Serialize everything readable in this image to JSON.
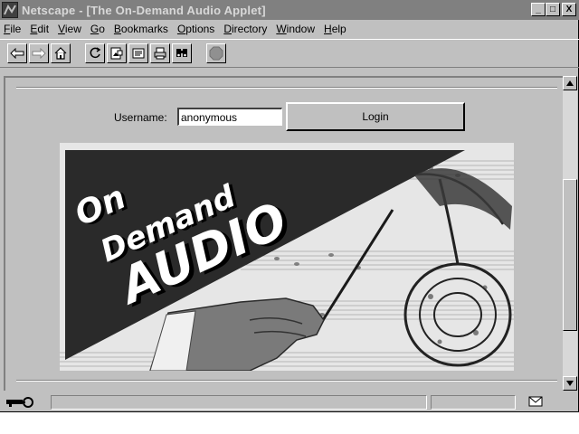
{
  "window": {
    "title": "Netscape - [The On-Demand Audio Applet]",
    "controls": [
      "_",
      "□",
      "X"
    ]
  },
  "menu": [
    {
      "label": "File",
      "key": "F",
      "rest": "ile"
    },
    {
      "label": "Edit",
      "key": "E",
      "rest": "dit"
    },
    {
      "label": "View",
      "key": "V",
      "rest": "iew"
    },
    {
      "label": "Go",
      "key": "G",
      "rest": "o"
    },
    {
      "label": "Bookmarks",
      "key": "B",
      "rest": "ookmarks"
    },
    {
      "label": "Options",
      "key": "O",
      "rest": "ptions"
    },
    {
      "label": "Directory",
      "key": "D",
      "rest": "irectory"
    },
    {
      "label": "Window",
      "key": "W",
      "rest": "indow"
    },
    {
      "label": "Help",
      "key": "H",
      "rest": "elp"
    }
  ],
  "toolbar": {
    "icons": [
      "back-arrow-icon",
      "forward-arrow-icon",
      "home-icon",
      "reload-icon",
      "images-icon",
      "open-icon",
      "print-icon",
      "find-icon",
      "stop-icon"
    ]
  },
  "login": {
    "username_label": "Username:",
    "username_value": "anonymous",
    "login_button": "Login"
  },
  "banner": {
    "line1": "On",
    "line2": "Demand",
    "line3": "AUDIO"
  },
  "colors": {
    "chrome": "#c0c0c0",
    "titlebar": "#808080",
    "banner_dark": "#2a2a2a"
  }
}
